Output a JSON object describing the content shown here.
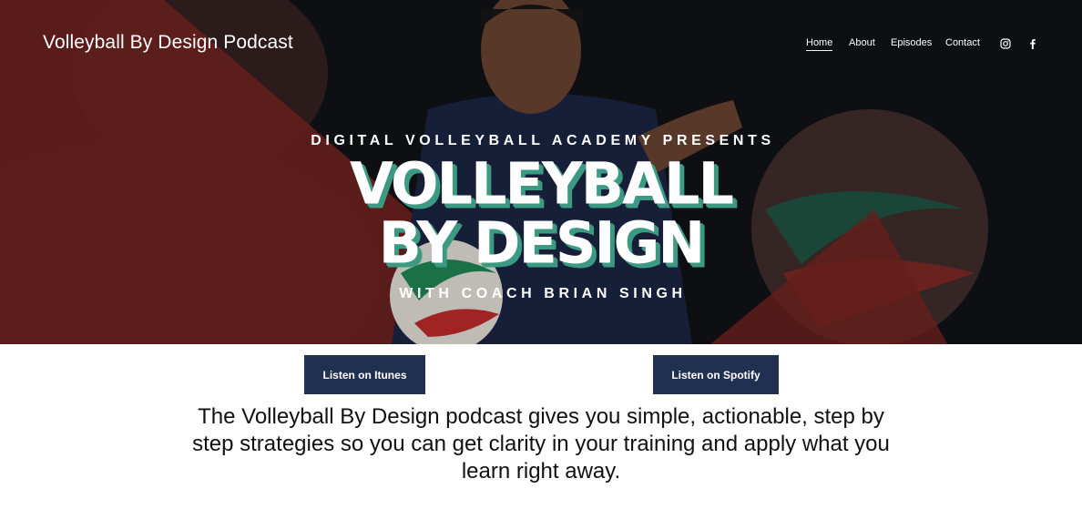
{
  "header": {
    "site_title": "Volleyball By Design Podcast",
    "nav": [
      {
        "label": "Home",
        "active": true
      },
      {
        "label": "About",
        "active": false
      },
      {
        "label": "Episodes",
        "active": false
      },
      {
        "label": "Contact",
        "active": false
      }
    ],
    "social_icons": [
      "instagram-icon",
      "facebook-icon"
    ]
  },
  "hero": {
    "kicker": "DIGITAL VOLLEYBALL ACADEMY PRESENTS",
    "title_line1": "VOLLEYBALL",
    "title_line2": "BY DESIGN",
    "byline": "WITH COACH BRIAN SINGH"
  },
  "buttons": {
    "itunes": "Listen on Itunes",
    "spotify": "Listen on Spotify"
  },
  "description": "The Volleyball By Design podcast gives you simple, actionable, step by step strategies so you can get clarity in your training and apply what you learn right away.",
  "colors": {
    "hero_dark": "#101114",
    "hero_red": "#7a2622",
    "title_shadow": "#3c9a82",
    "button_bg": "#1f3051",
    "text_dark": "#111111"
  }
}
